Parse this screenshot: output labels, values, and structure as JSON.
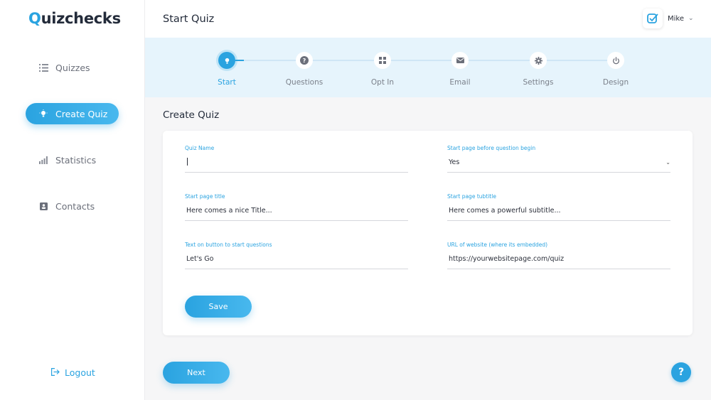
{
  "app": {
    "logo_first": "Q",
    "logo_rest": "uizchecks"
  },
  "sidebar": {
    "items": [
      {
        "label": "Quizzes",
        "icon": "list-icon"
      },
      {
        "label": "Create Quiz",
        "icon": "lightbulb-icon"
      },
      {
        "label": "Statistics",
        "icon": "bar-chart-icon"
      },
      {
        "label": "Contacts",
        "icon": "contact-card-icon"
      }
    ],
    "logout_label": "Logout"
  },
  "header": {
    "title": "Start Quiz",
    "user_name": "Mike",
    "user_caret": "⌄"
  },
  "stepper": {
    "steps": [
      {
        "label": "Start",
        "icon": "lightbulb-icon"
      },
      {
        "label": "Questions",
        "icon": "question-icon"
      },
      {
        "label": "Opt In",
        "icon": "grid-icon"
      },
      {
        "label": "Email",
        "icon": "envelope-icon"
      },
      {
        "label": "Settings",
        "icon": "gear-icon"
      },
      {
        "label": "Design",
        "icon": "power-icon"
      }
    ]
  },
  "form": {
    "section_title": "Create Quiz",
    "fields": {
      "quiz_name": {
        "label": "Quiz Name",
        "value": ""
      },
      "start_page_before": {
        "label": "Start page before question begin",
        "value": "Yes",
        "caret": "⌄"
      },
      "start_page_title": {
        "label": "Start page title",
        "value": "Here comes a nice Title..."
      },
      "start_page_subtitle": {
        "label": "Start page tubtitle",
        "value": "Here comes a powerful subtitle..."
      },
      "button_text": {
        "label": "Text on button to start questions",
        "value": "Let's Go"
      },
      "website_url": {
        "label": "URL of website (where its embedded)",
        "value": "https://yourwebsitepage.com/quiz"
      }
    },
    "save_label": "Save"
  },
  "footer": {
    "next_label": "Next",
    "help_label": "?"
  },
  "colors": {
    "accent": "#2aa3e0",
    "stepper_bg": "#e6f4fc",
    "text": "#232b3a"
  }
}
